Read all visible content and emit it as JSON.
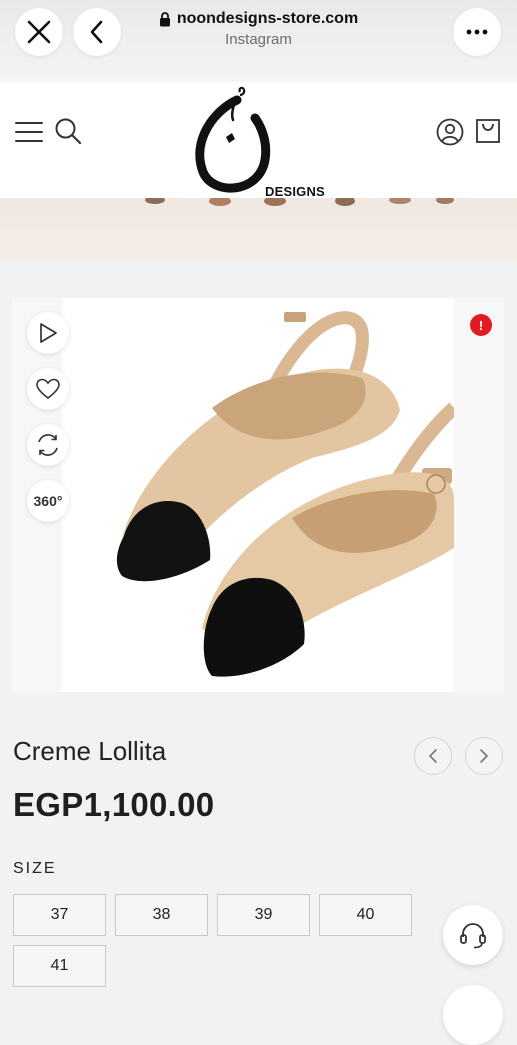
{
  "browser": {
    "url": "noondesigns-store.com",
    "source": "Instagram"
  },
  "header": {
    "logo_text": "DESIGNS"
  },
  "gallery": {
    "badge": "!",
    "view360_label": "360°"
  },
  "product": {
    "title": "Creme Lollita",
    "price": "EGP1,100.00",
    "size_label": "SIZE",
    "sizes": [
      "37",
      "38",
      "39",
      "40",
      "41"
    ]
  },
  "colors": {
    "accent_red": "#e21b23",
    "shoe_beige": "#e1c39e",
    "shoe_black": "#111111"
  },
  "icons": {
    "close": "close-icon",
    "back": "chevron-left-icon",
    "more": "more-icon",
    "lock": "lock-icon",
    "menu": "hamburger-menu-icon",
    "search": "search-icon",
    "account": "account-icon",
    "bag": "shopping-bag-icon",
    "play": "play-icon",
    "wishlist": "heart-icon",
    "rotate": "rotate-icon",
    "support": "headset-icon"
  }
}
